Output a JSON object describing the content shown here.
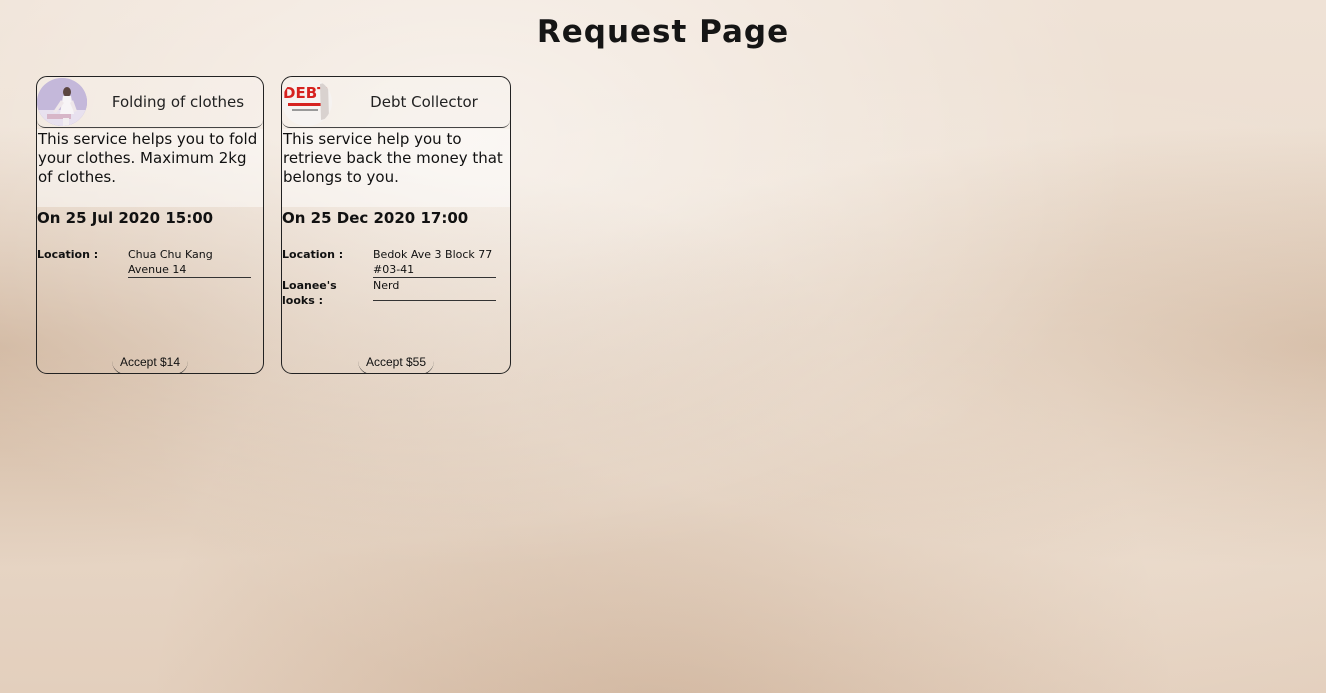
{
  "page": {
    "title": "Request Page"
  },
  "requests": [
    {
      "name": "Folding of clothes",
      "avatar_icon": "woman-folding-clothes-photo",
      "description": "This service helps you to fold your clothes. Maximum 2kg of clothes.",
      "date": "On 25 Jul 2020 15:00",
      "location_label": "Location :",
      "location": "Chua Chu Kang Avenue 14",
      "accept_label": "Accept $14"
    },
    {
      "name": "Debt Collector",
      "avatar_icon": "debt-collector-logo",
      "avatar_text": "DEBT",
      "description": "This service help you to retrieve back the money that belongs to you.",
      "date": "On 25 Dec 2020 17:00",
      "location_label": "Location :",
      "location": "Bedok Ave 3 Block 77 #03-41",
      "looks_label": "Loanee's looks :",
      "looks": "Nerd",
      "accept_label": "Accept $55"
    }
  ]
}
